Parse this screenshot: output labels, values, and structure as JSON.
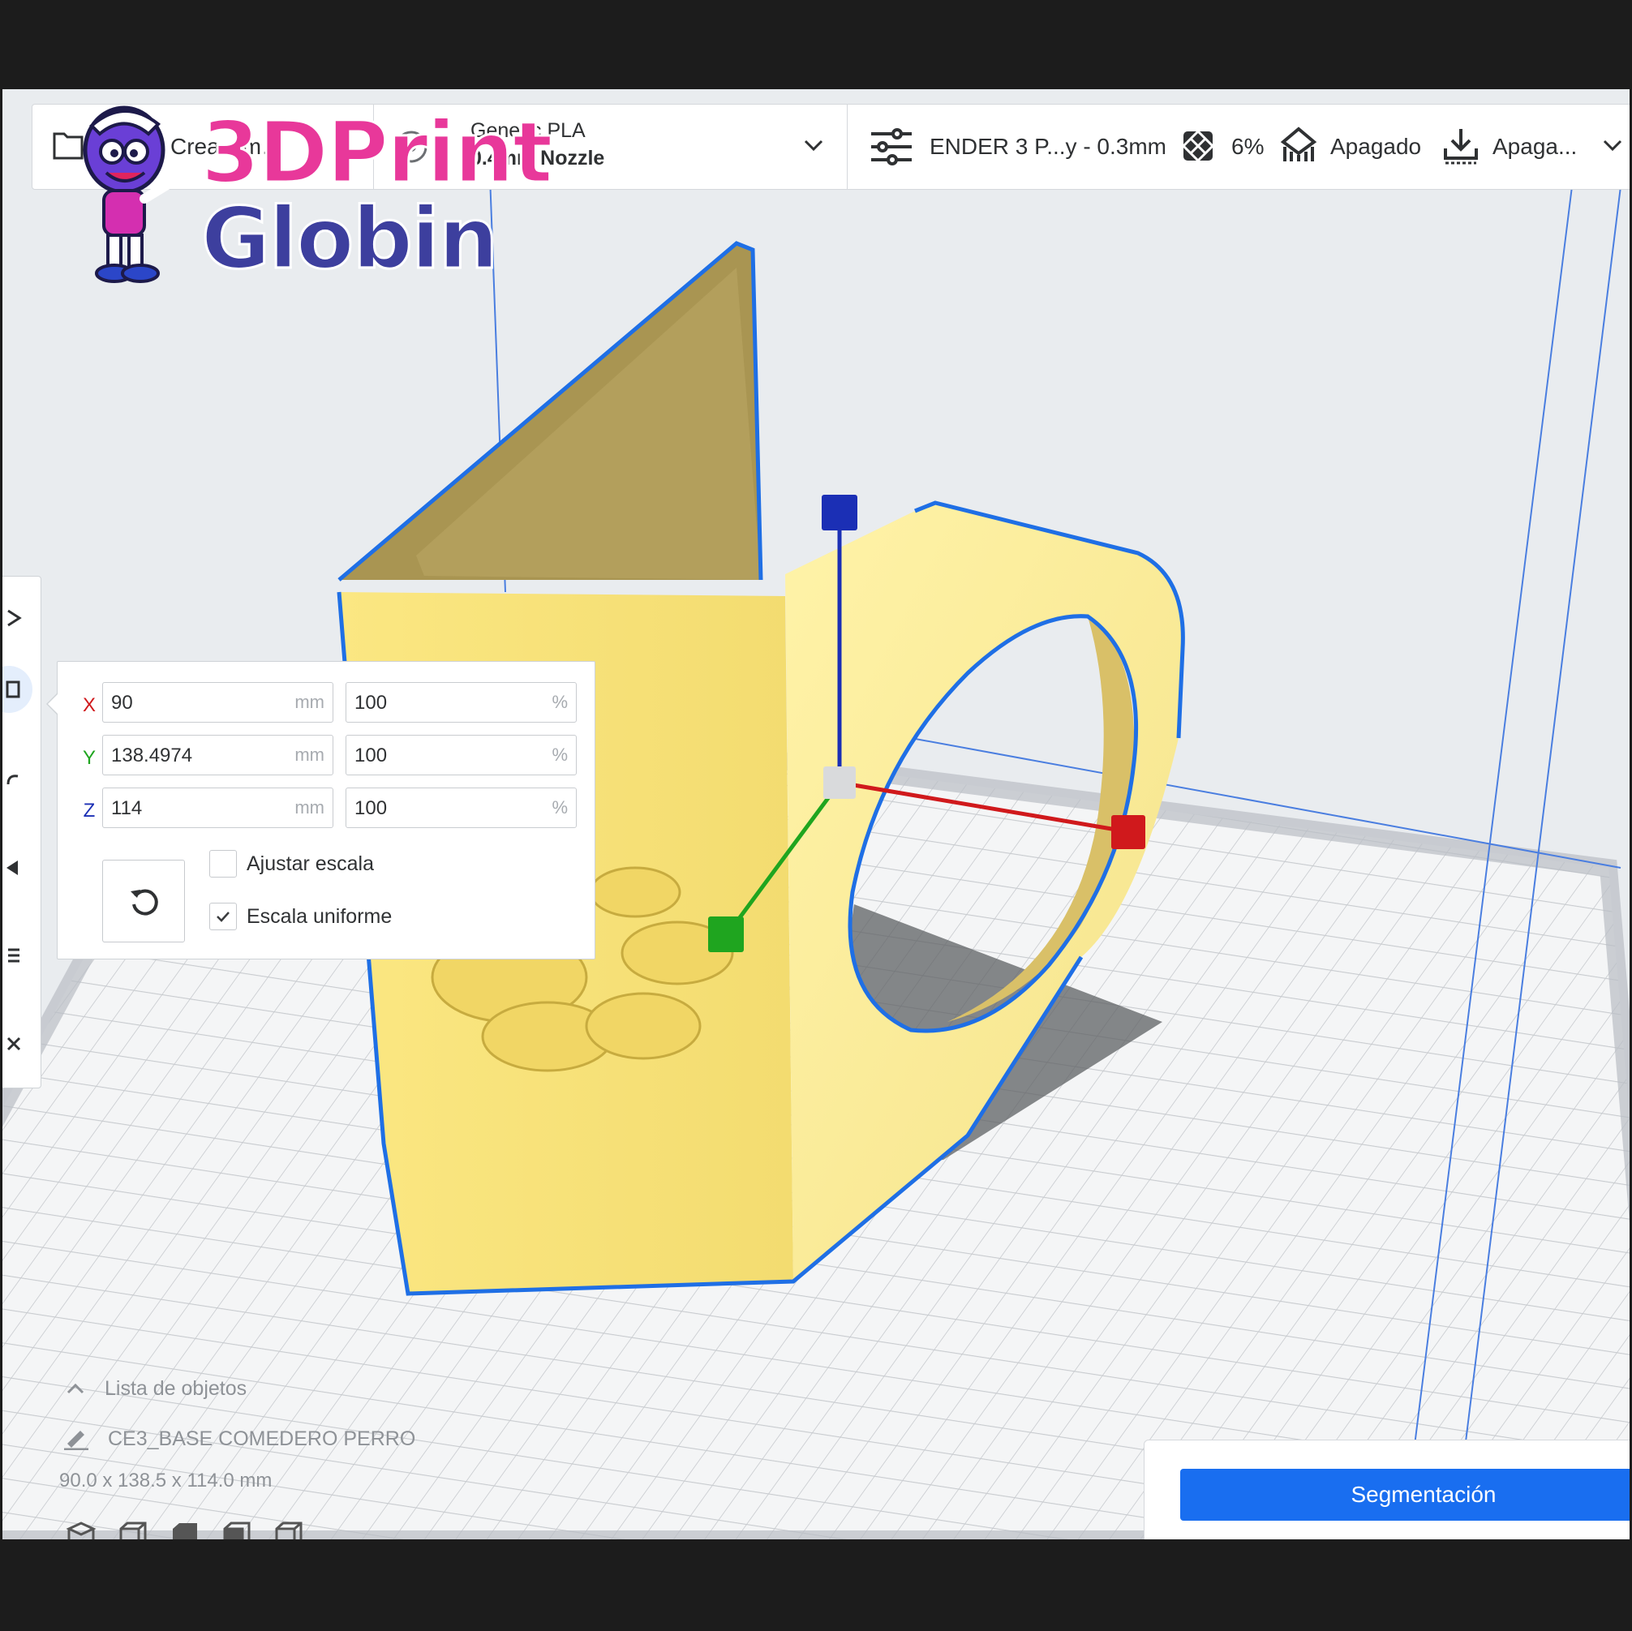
{
  "logo": {
    "line1": "3DPrint",
    "line2": "Globin",
    "colors": {
      "line1": "#e8389a",
      "line2": "#3d3f9e"
    }
  },
  "topbar": {
    "project_name": "Crea…m…",
    "material": "Generic PLA",
    "nozzle": "0.4mm Nozzle",
    "profile": "ENDER 3 P...y - 0.3mm",
    "infill": "6%",
    "support": "Apagado",
    "adhesion": "Apaga..."
  },
  "scale_panel": {
    "x": {
      "label": "X",
      "mm": "90",
      "mm_unit": "mm",
      "percent": "100",
      "percent_unit": "%"
    },
    "y": {
      "label": "Y",
      "mm": "138.4974",
      "mm_unit": "mm",
      "percent": "100",
      "percent_unit": "%"
    },
    "z": {
      "label": "Z",
      "mm": "114",
      "mm_unit": "mm",
      "percent": "100",
      "percent_unit": "%"
    },
    "snap_scaling": {
      "label": "Ajustar escala",
      "checked": false
    },
    "uniform_scaling": {
      "label": "Escala uniforme",
      "checked": true
    }
  },
  "object_list": {
    "header": "Lista de objetos",
    "object_name": "CE3_BASE COMEDERO PERRO",
    "dimensions": "90.0 x 138.5 x 114.0 mm"
  },
  "slice": {
    "button_label": "Segmentación"
  },
  "colors": {
    "accent": "#196ef0",
    "axis_x": "#d0191c",
    "axis_y": "#1fa51f",
    "axis_z": "#1b2fb5",
    "model": "#f6df6e",
    "outline": "#1f6fe5"
  },
  "icons": [
    "folder-icon",
    "material-icon",
    "chevron-down-icon",
    "settings-sliders-icon",
    "infill-icon",
    "support-icon",
    "adhesion-icon",
    "reset-icon",
    "pencil-icon",
    "chevron-up-icon"
  ]
}
